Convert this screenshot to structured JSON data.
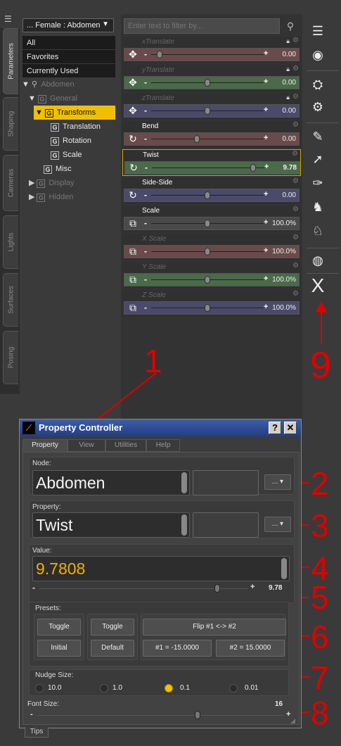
{
  "side_tabs": [
    "Parameters",
    "Shaping",
    "Cameras",
    "Lights",
    "Surfaces",
    "Posing"
  ],
  "node_dropdown": {
    "label": "... Female : Abdomen",
    "arrow": "▼"
  },
  "list_items": [
    "All",
    "Favorites",
    "Currently Used"
  ],
  "tree": {
    "abdomen": "Abdomen",
    "general": "General",
    "transforms": "Transforms",
    "translation": "Translation",
    "rotation": "Rotation",
    "scale": "Scale",
    "misc": "Misc",
    "display": "Display",
    "hidden": "Hidden"
  },
  "filter": {
    "placeholder": "Enter text to filter by..."
  },
  "params": [
    {
      "label": "xTranslate",
      "value": "0.00",
      "dim": true,
      "track_color": "#6a4a4a",
      "icon": "move-icon",
      "knob": 0.05
    },
    {
      "label": "yTranslate",
      "value": "0.00",
      "dim": true,
      "track_color": "#4a6a4a",
      "icon": "move-icon",
      "knob": 0.5
    },
    {
      "label": "zTranslate",
      "value": "0.00",
      "dim": true,
      "track_color": "#4a4a6a",
      "icon": "move-icon",
      "knob": 0.5
    },
    {
      "label": "Bend",
      "value": "0.00",
      "dim": false,
      "track_color": "#6a4a4a",
      "icon": "rotate-icon",
      "knob": 0.4
    },
    {
      "label": "Twist",
      "value": "9.78",
      "dim": false,
      "track_color": "#4a6a4a",
      "icon": "rotate-icon",
      "knob": 0.92
    },
    {
      "label": "Side-Side",
      "value": "0.00",
      "dim": false,
      "track_color": "#4a4a6a",
      "icon": "rotate-icon",
      "knob": 0.5
    },
    {
      "label": "Scale",
      "value": "100.0%",
      "dim": false,
      "track_color": "#4a4a4a",
      "icon": "scale-icon",
      "knob": 0.5
    },
    {
      "label": "X Scale",
      "value": "100.0%",
      "dim": true,
      "track_color": "#6a4a4a",
      "icon": "scale-icon",
      "knob": 0.5
    },
    {
      "label": "Y Scale",
      "value": "100.0%",
      "dim": true,
      "track_color": "#4a6a4a",
      "icon": "scale-icon",
      "knob": 0.5
    },
    {
      "label": "Z Scale",
      "value": "100.0%",
      "dim": true,
      "track_color": "#4a4a6a",
      "icon": "scale-icon",
      "knob": 0.5
    }
  ],
  "right_toolbar_icons": [
    "panel-icon",
    "target-icon",
    "puppeteer-icon",
    "hierarchy-icon",
    "pose-icon",
    "aim-icon",
    "ik-icon",
    "figure-icon",
    "figure-alt-icon",
    "globe-icon",
    "close-x-icon"
  ],
  "right_toolbar_x": "X",
  "annotations": [
    "1",
    "2",
    "3",
    "4",
    "5",
    "6",
    "7",
    "8",
    "9"
  ],
  "property_controller": {
    "title": "Property Controller",
    "help": "?",
    "close": "✕",
    "tabs": [
      "Property",
      "View",
      "Utilities",
      "Help"
    ],
    "node_label": "Node:",
    "node_value": "Abdomen",
    "property_label": "Property:",
    "property_value": "Twist",
    "dots": "... ▾",
    "value_label": "Value:",
    "value": "9.7808",
    "slider_value": "9.78",
    "slider_fraction": 0.84,
    "presets_label": "Presets:",
    "toggle1": "Toggle",
    "initial": "Initial",
    "toggle2": "Toggle",
    "default": "Default",
    "flip": "Flip #1 <-> #2",
    "preset1": "#1 = -15.0000",
    "preset2": "#2 = 15.0000",
    "nudge_label": "Nudge Size:",
    "nudge_options": [
      "10.0",
      "1.0",
      "0.1",
      "0.01"
    ],
    "nudge_selected": "0.1",
    "font_size_label": "Font Size:",
    "font_size_value": "16",
    "font_fraction": 0.64,
    "minus": "-",
    "plus": "+"
  },
  "tips_tab": "Tips",
  "colors": {
    "accent": "#f0c000",
    "annotation": "#e00000",
    "value_text": "#f0b000"
  }
}
